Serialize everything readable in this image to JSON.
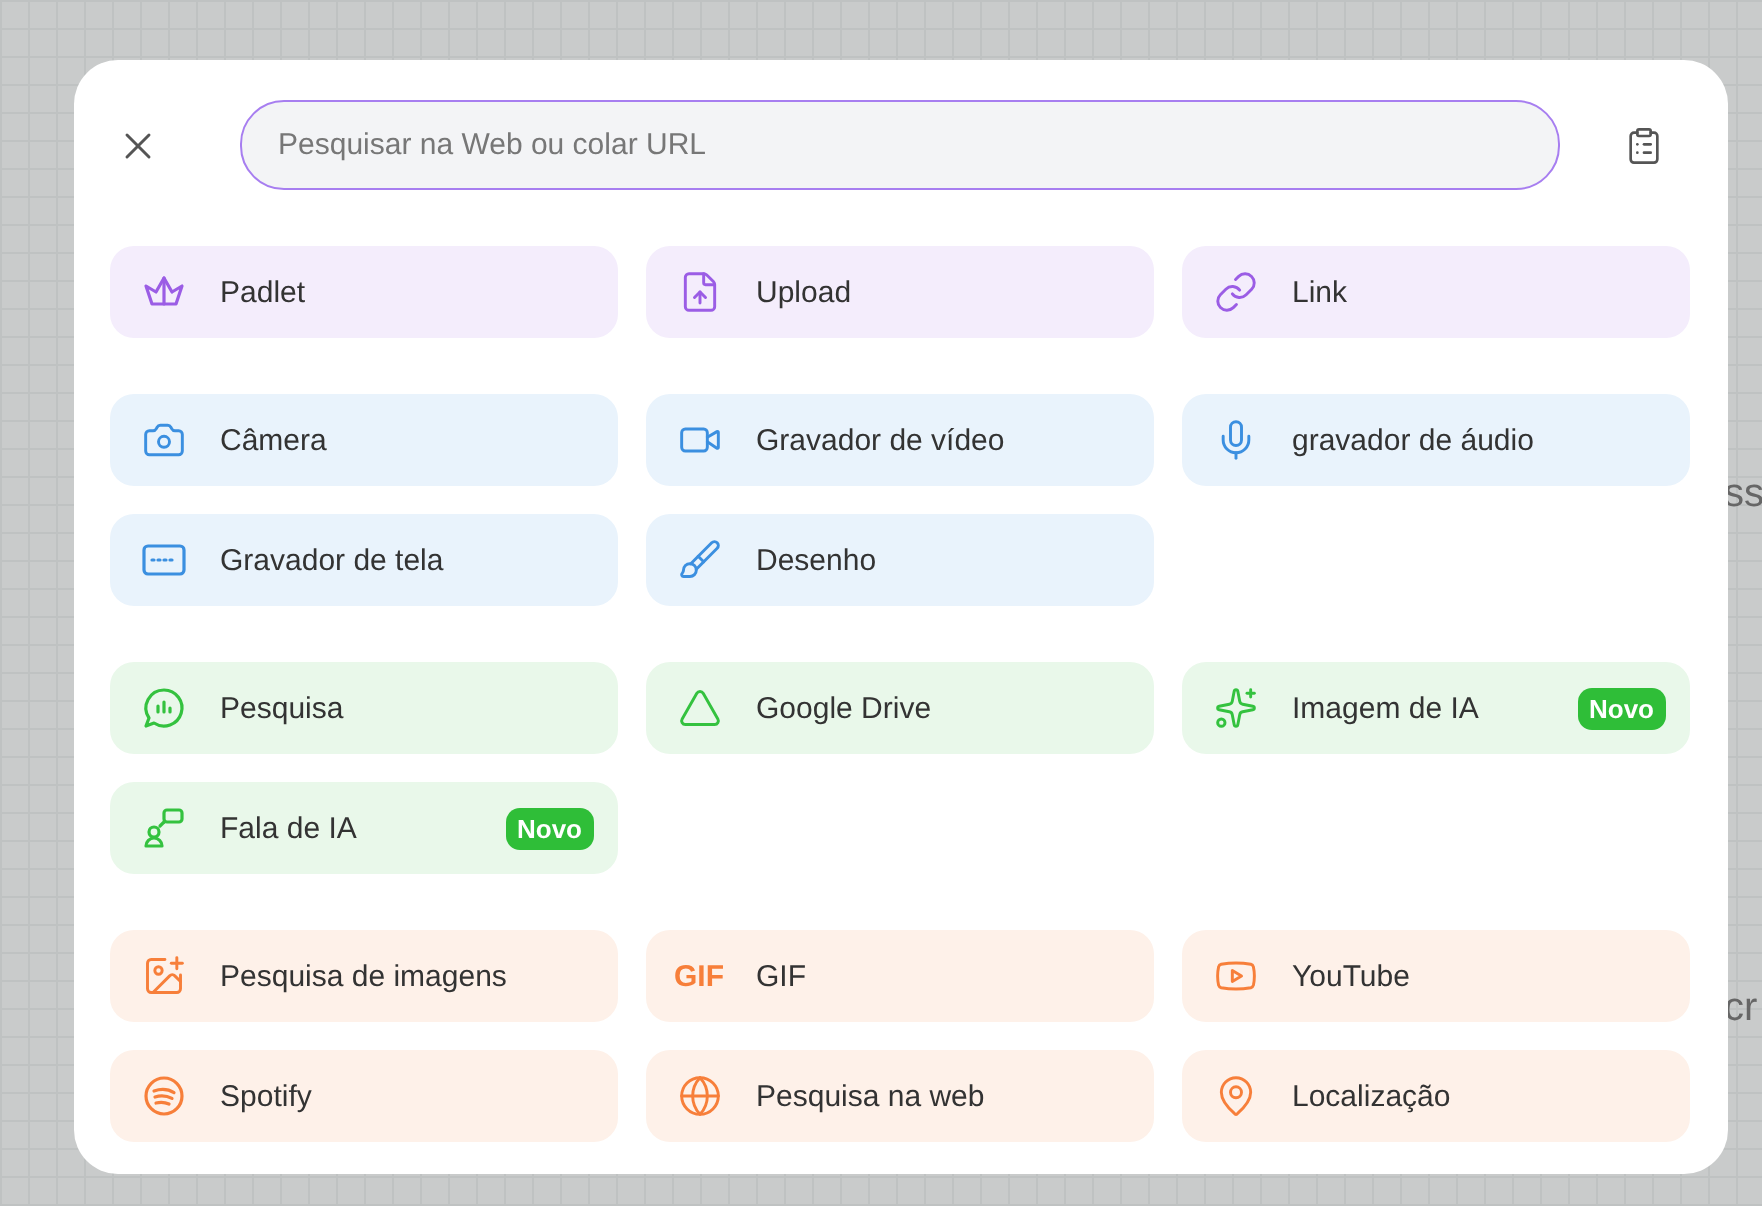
{
  "background_texts": [
    "ss",
    "cr"
  ],
  "search": {
    "placeholder": "Pesquisar na Web ou colar URL"
  },
  "groups": [
    {
      "color": "#9b5de5",
      "items": [
        {
          "kind": "padlet",
          "label": "Padlet"
        },
        {
          "kind": "upload",
          "label": "Upload"
        },
        {
          "kind": "link",
          "label": "Link"
        }
      ]
    },
    {
      "color": "#3b8fe0",
      "items": [
        {
          "kind": "camera",
          "label": "Câmera"
        },
        {
          "kind": "video",
          "label": "Gravador de vídeo"
        },
        {
          "kind": "mic",
          "label": "gravador de áudio"
        },
        {
          "kind": "screen",
          "label": "Gravador de tela"
        },
        {
          "kind": "brush",
          "label": "Desenho"
        }
      ]
    },
    {
      "color": "#34c23f",
      "items": [
        {
          "kind": "poll",
          "label": "Pesquisa"
        },
        {
          "kind": "drive",
          "label": "Google Drive"
        },
        {
          "kind": "sparkles",
          "label": "Imagem de IA",
          "badge": "Novo"
        },
        {
          "kind": "speech",
          "label": "Fala de IA",
          "badge": "Novo"
        }
      ]
    },
    {
      "color": "#f77f3a",
      "items": [
        {
          "kind": "imagesearch",
          "label": "Pesquisa de imagens"
        },
        {
          "kind": "gif",
          "icon_text": "GIF",
          "label": "GIF"
        },
        {
          "kind": "youtube",
          "label": "YouTube"
        },
        {
          "kind": "spotify",
          "label": "Spotify"
        },
        {
          "kind": "globe",
          "label": "Pesquisa na web"
        },
        {
          "kind": "pin",
          "label": "Localização"
        }
      ]
    }
  ]
}
